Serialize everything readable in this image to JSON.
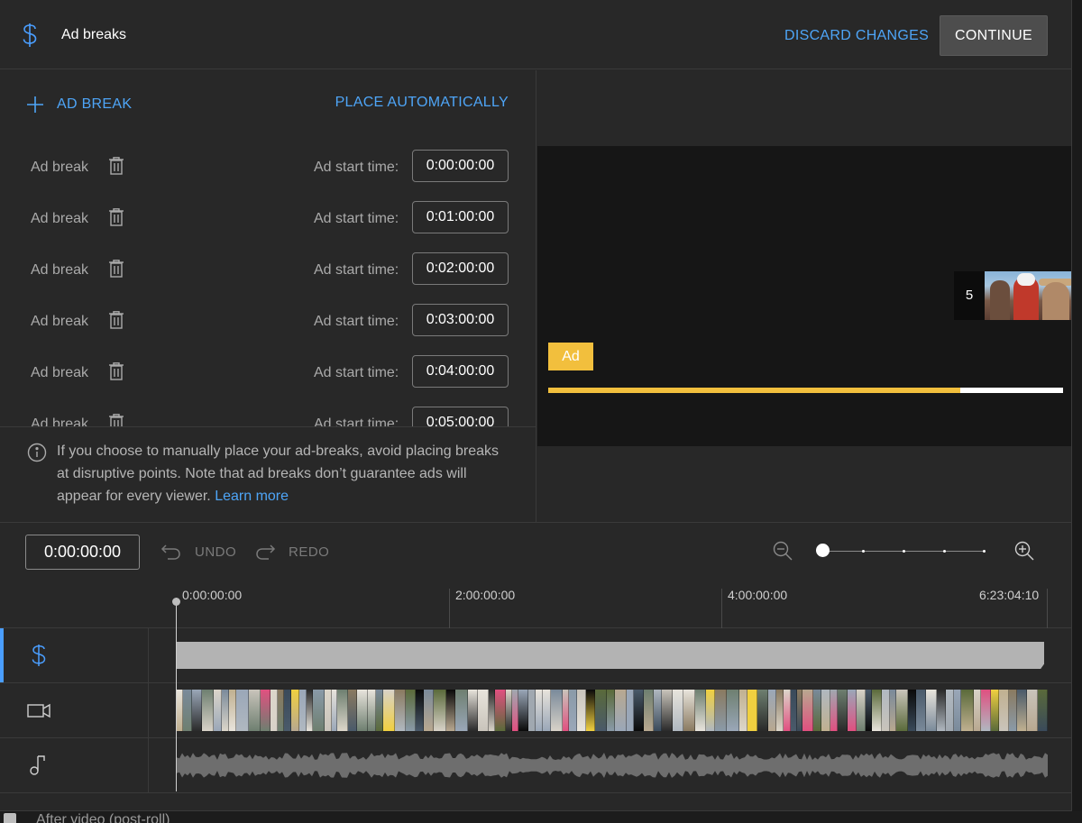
{
  "header": {
    "title": "Ad breaks",
    "discard_label": "DISCARD CHANGES",
    "continue_label": "CONTINUE"
  },
  "left_panel": {
    "add_label": "AD BREAK",
    "place_auto_label": "PLACE AUTOMATICALLY",
    "start_time_label": "Ad start time:",
    "breaks": [
      {
        "label": "Ad break",
        "start": "0:00:00:00"
      },
      {
        "label": "Ad break",
        "start": "0:01:00:00"
      },
      {
        "label": "Ad break",
        "start": "0:02:00:00"
      },
      {
        "label": "Ad break",
        "start": "0:03:00:00"
      },
      {
        "label": "Ad break",
        "start": "0:04:00:00"
      },
      {
        "label": "Ad break",
        "start": "0:05:00:00"
      }
    ],
    "info_text": "If you choose to manually place your ad-breaks, avoid placing breaks at disruptive points. Note that ad breaks don’t guarantee ads will appear for every viewer.",
    "learn_more": "Learn more"
  },
  "preview": {
    "ad_badge": "Ad",
    "thumb_count": "5",
    "progress_fraction": 0.8
  },
  "toolbar": {
    "current_time": "0:00:00:00",
    "undo_label": "UNDO",
    "redo_label": "REDO"
  },
  "ruler": {
    "ticks": [
      "0:00:00:00",
      "2:00:00:00",
      "4:00:00:00",
      "6:23:04:10"
    ]
  },
  "background": {
    "underlying_text": "After video (post-roll)"
  },
  "colors": {
    "accent_blue": "#4ea5f7",
    "ad_yellow": "#f2bf3d",
    "panel_bg": "#282828"
  }
}
